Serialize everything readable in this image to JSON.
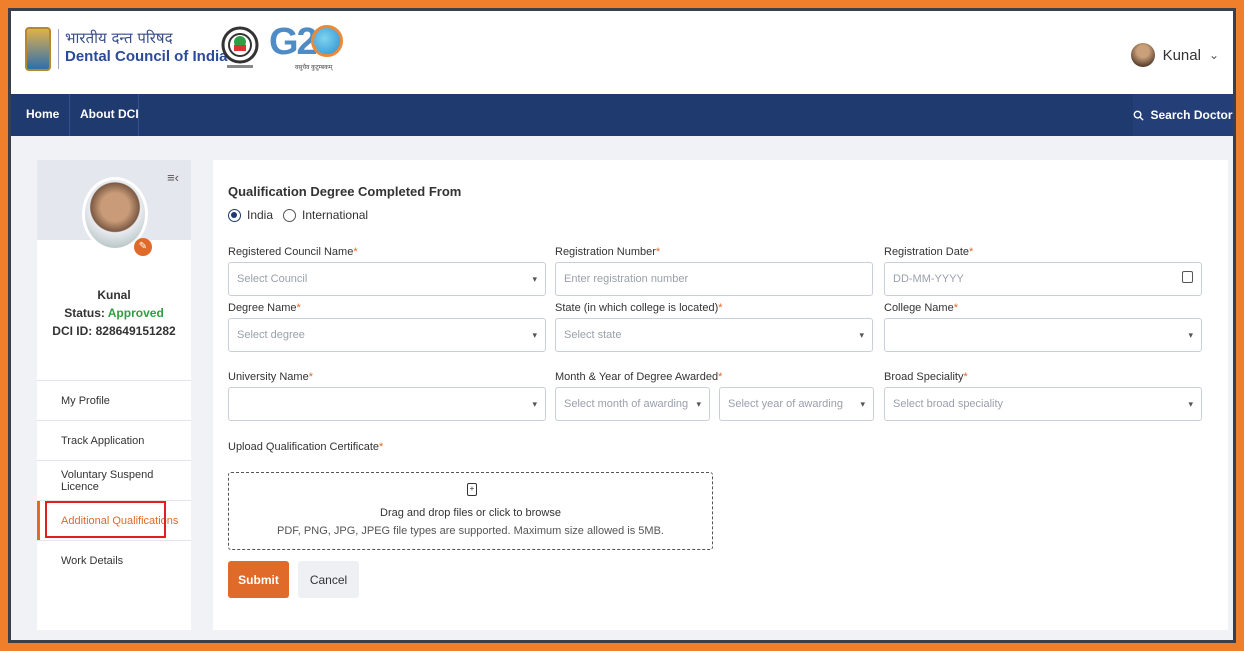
{
  "header": {
    "org_hindi": "भारतीय दन्त परिषद",
    "org_english": "Dental Council of India",
    "g20_text": "G20",
    "g20_sub": "वसुधैव कुटुम्बकम्",
    "user_name": "Kunal"
  },
  "nav": {
    "items": [
      "Home",
      "About DCI"
    ],
    "search_label": "Search Doctor",
    "bg_color": "#1f3a6f"
  },
  "sidebar": {
    "profile_name": "Kunal",
    "status_label": "Status:",
    "status_value": "Approved",
    "dci_id": "DCI ID: 828649151282",
    "menu": [
      "My Profile",
      "Track Application",
      "Voluntary Suspend Licence",
      "Additional Qualifications",
      "Work Details"
    ],
    "active_item": "Additional Qualifications"
  },
  "form": {
    "section_title": "Qualification Degree Completed From",
    "radio_options": [
      "India",
      "International"
    ],
    "radio_selected": "India",
    "labels": {
      "council": "Registered Council Name",
      "reg_no": "Registration Number",
      "reg_date": "Registration Date",
      "degree": "Degree Name",
      "state": "State (in which college is located)",
      "college": "College Name",
      "university": "University Name",
      "month_year": "Month & Year of Degree Awarded",
      "speciality": "Broad Speciality",
      "upload": "Upload Qualification Certificate"
    },
    "placeholders": {
      "council": "Select Council",
      "reg_no": "Enter registration number",
      "reg_date": "DD-MM-YYYY",
      "degree": "Select degree",
      "state": "Select state",
      "college": "",
      "university": "",
      "month": "Select month of awarding",
      "year": "Select year of awarding",
      "speciality": "Select broad speciality"
    },
    "dropzone_main": "Drag and drop files or click to browse",
    "dropzone_sub": "PDF, PNG, JPG, JPEG file types are supported. Maximum size allowed is 5MB.",
    "submit_label": "Submit",
    "cancel_label": "Cancel",
    "accent_color": "#e06a2a"
  }
}
